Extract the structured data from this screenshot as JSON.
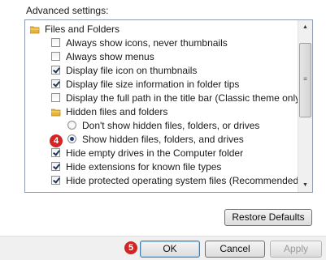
{
  "advanced_label": "Advanced settings:",
  "tree": {
    "group1": "Files and Folders",
    "items": [
      {
        "label": "Always show icons, never thumbnails",
        "checked": false
      },
      {
        "label": "Always show menus",
        "checked": false
      },
      {
        "label": "Display file icon on thumbnails",
        "checked": true
      },
      {
        "label": "Display file size information in folder tips",
        "checked": true
      },
      {
        "label": "Display the full path in the title bar (Classic theme only)",
        "checked": false
      }
    ],
    "group2": "Hidden files and folders",
    "radios": [
      {
        "label": "Don't show hidden files, folders, or drives",
        "selected": false
      },
      {
        "label": "Show hidden files, folders, and drives",
        "selected": true
      }
    ],
    "items2": [
      {
        "label": "Hide empty drives in the Computer folder",
        "checked": true
      },
      {
        "label": "Hide extensions for known file types",
        "checked": true
      },
      {
        "label": "Hide protected operating system files (Recommended)",
        "checked": true
      }
    ]
  },
  "badges": {
    "step4": "4",
    "step5": "5"
  },
  "buttons": {
    "restore": "Restore Defaults",
    "ok": "OK",
    "cancel": "Cancel",
    "apply": "Apply"
  },
  "colors": {
    "badge": "#d42424",
    "check": "#21355a"
  },
  "icons": {
    "folder": "folder-icon",
    "scroll_up": "scroll-up-arrow-icon",
    "scroll_down": "scroll-down-arrow-icon"
  }
}
